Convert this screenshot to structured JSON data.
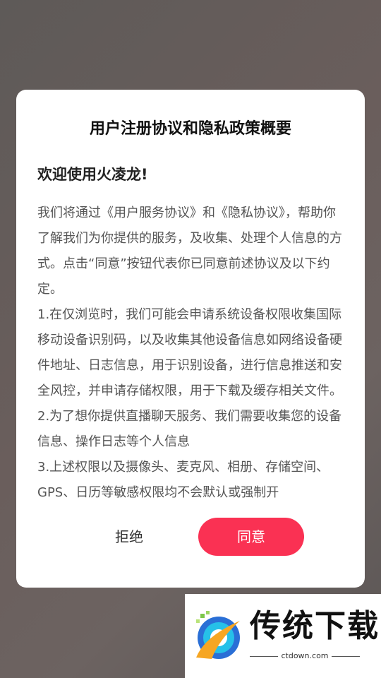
{
  "dialog": {
    "title": "用户注册协议和隐私政策概要",
    "welcome": "欢迎使用火凌龙!",
    "paragraphs": [
      "我们将通过《用户服务协议》和《隐私协议》，帮助你了解我们为你提供的服务，及收集、处理个人信息的方式。点击“同意”按钮代表你已同意前述协议及以下约定。",
      "1.在仅浏览时，我们可能会申请系统设备权限收集国际移动设备识别码，以及收集其他设备信息如网络设备硬件地址、日志信息，用于识别设备，进行信息推送和安全风控，并申请存储权限，用于下载及缓存相关文件。",
      "2.为了想你提供直播聊天服务、我们需要收集您的设备信息、操作日志等个人信息",
      "3.上述权限以及摄像头、麦克风、相册、存储空间、GPS、日历等敏感权限均不会默认或强制开"
    ],
    "reject_label": "拒绝",
    "agree_label": "同意",
    "accent_color": "#fa3153"
  },
  "watermark": {
    "brand": "传统下载",
    "domain": "ctdown.com"
  }
}
